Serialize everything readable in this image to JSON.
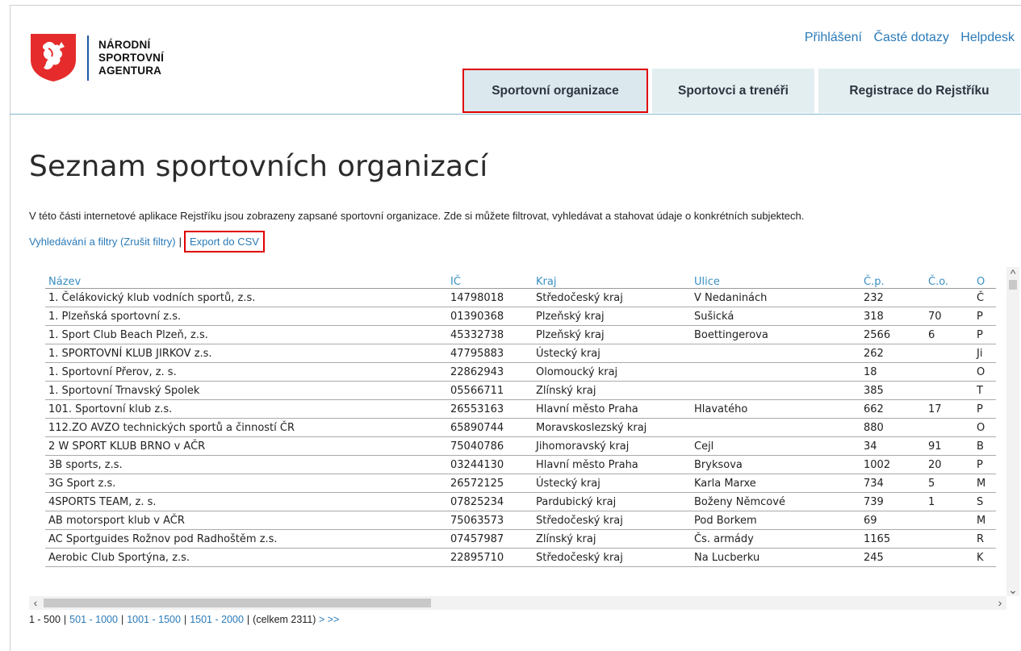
{
  "brand": {
    "line1": "NÁRODNÍ",
    "line2": "SPORTOVNÍ",
    "line3": "AGENTURA",
    "crest_icon": "czech-lion-crest-icon",
    "colors": {
      "red": "#e52b2b",
      "blue": "#1f57a6",
      "link": "#2a7ab8",
      "highlight": "#e00000"
    }
  },
  "top_links": [
    "Přihlášení",
    "Časté dotazy",
    "Helpdesk"
  ],
  "nav": {
    "tabs": [
      "Sportovní organizace",
      "Sportovci a trenéři",
      "Registrace do Rejstříku"
    ]
  },
  "page": {
    "title": "Seznam sportovních organizací",
    "intro": "V této části internetové aplikace Rejstříku jsou zobrazeny zapsané sportovní organizace. Zde si můžete filtrovat, vyhledávat a stahovat údaje o konkrétních subjektech.",
    "filters_label": "Vyhledávání a filtry (Zrušit filtry)",
    "separator": "|",
    "export_label": "Export do CSV"
  },
  "table": {
    "headers": [
      "Název",
      "IČ",
      "Kraj",
      "Ulice",
      "Č.p.",
      "Č.o.",
      "O"
    ],
    "rows": [
      [
        "1. Čelákovický klub vodních sportů, z.s.",
        "14798018",
        "Středočeský kraj",
        "V Nedaninách",
        "232",
        "",
        "Č"
      ],
      [
        "1. Plzeňská sportovní z.s.",
        "01390368",
        "Plzeňský kraj",
        "Sušická",
        "318",
        "70",
        "P"
      ],
      [
        "1. Sport Club Beach Plzeň, z.s.",
        "45332738",
        "Plzeňský kraj",
        "Boettingerova",
        "2566",
        "6",
        "P"
      ],
      [
        "1. SPORTOVNÍ KLUB JIRKOV z.s.",
        "47795883",
        "Ústecký kraj",
        "",
        "262",
        "",
        "Ji"
      ],
      [
        "1. Sportovní Přerov, z. s.",
        "22862943",
        "Olomoucký kraj",
        "",
        "18",
        "",
        "O"
      ],
      [
        "1. Sportovní Trnavský Spolek",
        "05566711",
        "Zlínský kraj",
        "",
        "385",
        "",
        "T"
      ],
      [
        "101. Sportovní klub z.s.",
        "26553163",
        "Hlavní město Praha",
        "Hlavatého",
        "662",
        "17",
        "P"
      ],
      [
        "112.ZO AVZO technických sportů a činností ČR",
        "65890744",
        "Moravskoslezský kraj",
        "",
        "880",
        "",
        "O"
      ],
      [
        "2 W SPORT KLUB BRNO v AČR",
        "75040786",
        "Jihomoravský kraj",
        "Cejl",
        "34",
        "91",
        "B"
      ],
      [
        "3B sports, z.s.",
        "03244130",
        "Hlavní město Praha",
        "Bryksova",
        "1002",
        "20",
        "P"
      ],
      [
        "3G Sport z.s.",
        "26572125",
        "Ústecký kraj",
        "Karla Marxe",
        "734",
        "5",
        "M"
      ],
      [
        "4SPORTS TEAM, z. s.",
        "07825234",
        "Pardubický kraj",
        "Boženy Němcové",
        "739",
        "1",
        "S"
      ],
      [
        "AB motorsport klub v AČR",
        "75063573",
        "Středočeský kraj",
        "Pod Borkem",
        "69",
        "",
        "M"
      ],
      [
        "AC Sportguides Rožnov pod Radhoštěm z.s.",
        "07457987",
        "Zlínský kraj",
        "Čs. armády",
        "1165",
        "",
        "R"
      ],
      [
        "Aerobic Club Sportýna, z.s.",
        "22895710",
        "Středočeský kraj",
        "Na Lucberku",
        "245",
        "",
        "K"
      ]
    ]
  },
  "pager": {
    "current": "1 - 500",
    "links": [
      "501 - 1000",
      "1001 - 1500",
      "1501 - 2000"
    ],
    "total": "(celkem 2311)",
    "next": ">",
    "last": ">>"
  }
}
